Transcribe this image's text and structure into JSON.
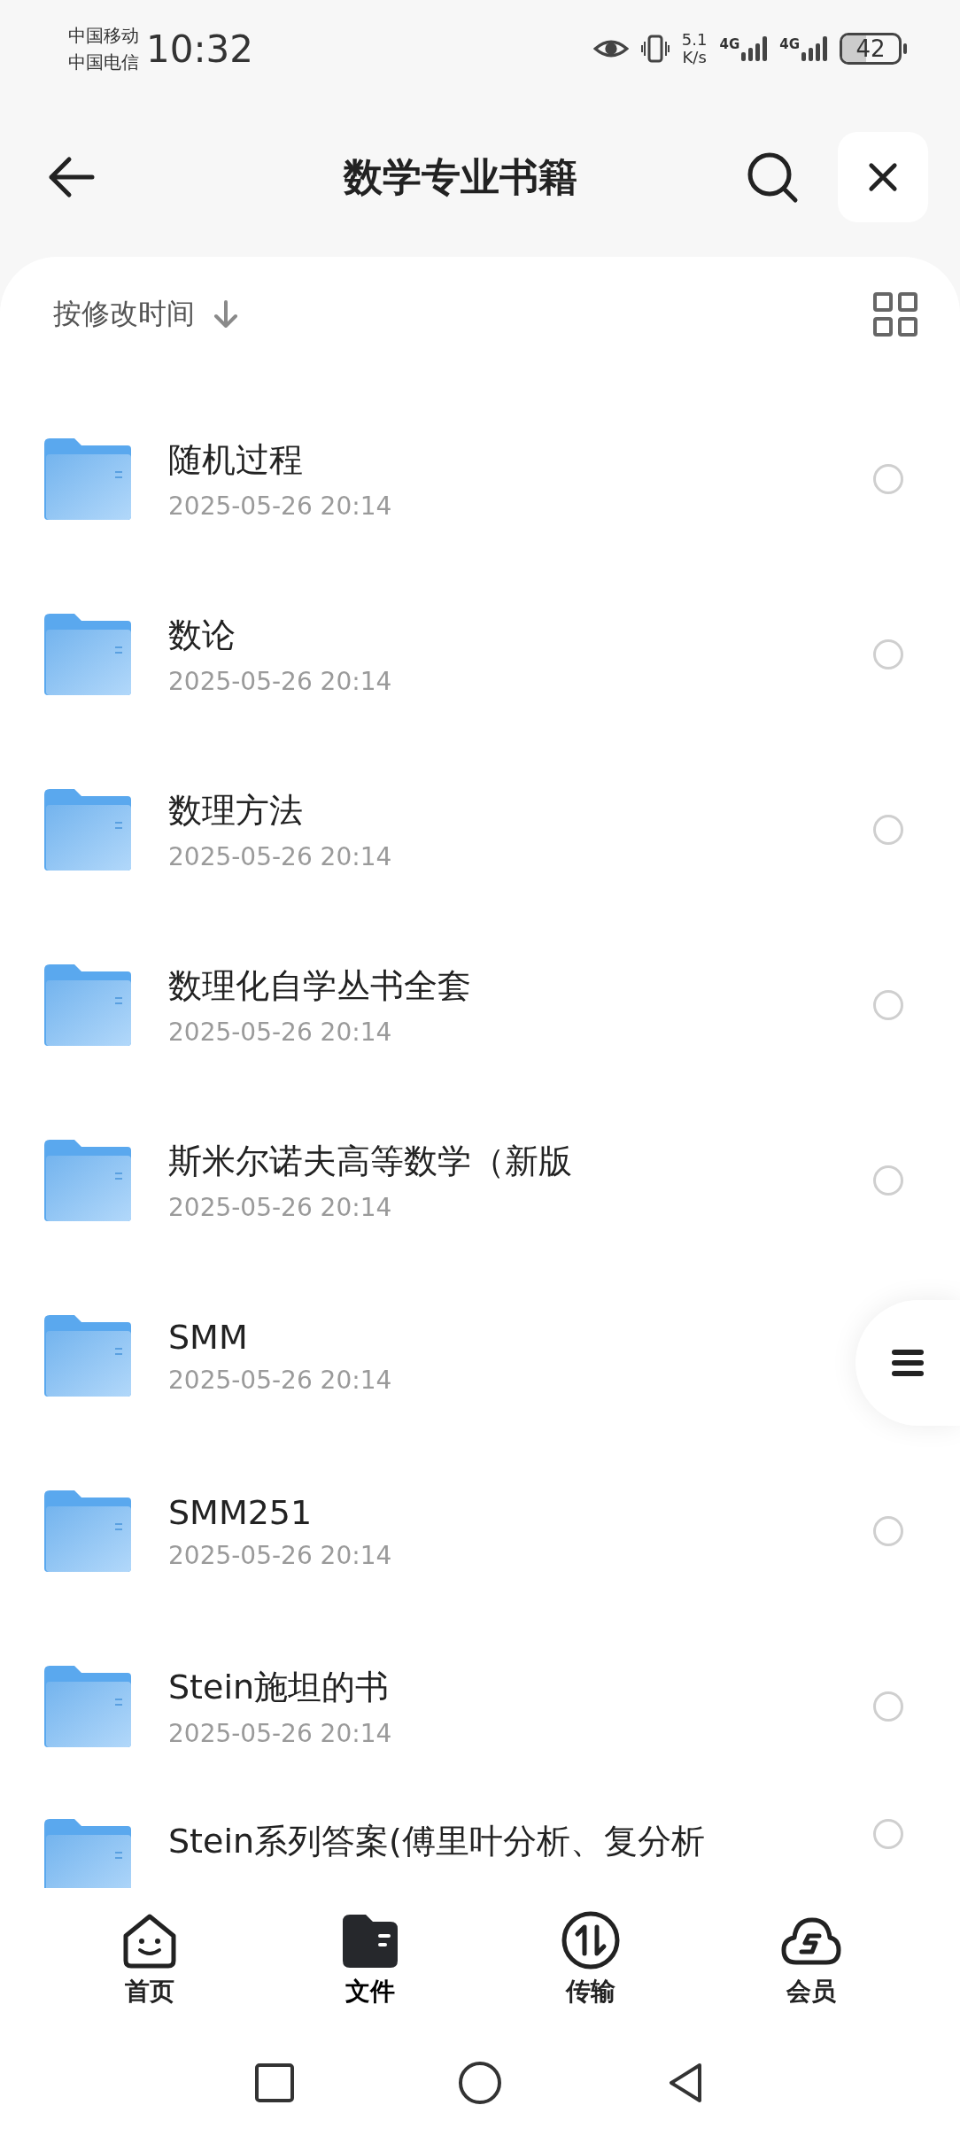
{
  "status_bar": {
    "carriers": [
      "中国移动",
      "中国电信"
    ],
    "time": "10:32",
    "speed_value": "5.1",
    "speed_unit": "K/s",
    "networks": [
      "4G",
      "4G"
    ],
    "battery": "42"
  },
  "header": {
    "title": "数学专业书籍"
  },
  "sort": {
    "label": "按修改时间"
  },
  "folders": [
    {
      "name": "随机过程",
      "date": "2025-05-26 20:14",
      "selected": false
    },
    {
      "name": "数论",
      "date": "2025-05-26 20:14",
      "selected": false
    },
    {
      "name": "数理方法",
      "date": "2025-05-26 20:14",
      "selected": false
    },
    {
      "name": "数理化自学丛书全套",
      "date": "2025-05-26 20:14",
      "selected": false
    },
    {
      "name": "斯米尔诺夫高等数学（新版",
      "date": "2025-05-26 20:14",
      "selected": false
    },
    {
      "name": "SMM",
      "date": "2025-05-26 20:14"
    },
    {
      "name": "SMM251",
      "date": "2025-05-26 20:14",
      "selected": false
    },
    {
      "name": "Stein施坦的书",
      "date": "2025-05-26 20:14",
      "selected": false
    },
    {
      "name": "Stein系列答案(傅里叶分析、复分析",
      "selected": false
    }
  ],
  "tabs": [
    {
      "kind": "home",
      "label": "首页",
      "selected": false
    },
    {
      "kind": "files",
      "label": "文件",
      "selected": true
    },
    {
      "kind": "transfer",
      "label": "传输",
      "selected": false
    },
    {
      "kind": "vip",
      "label": "会员",
      "selected": false
    }
  ]
}
